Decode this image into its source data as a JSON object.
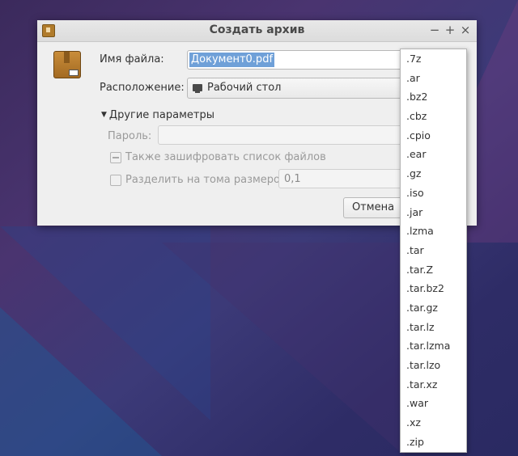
{
  "window": {
    "title": "Создать архив",
    "controls": {
      "minimize": "−",
      "maximize": "+",
      "close": "×"
    }
  },
  "form": {
    "filename_label": "Имя файла:",
    "filename_value": "Документ0.pdf",
    "location_label": "Расположение:",
    "location_value": "Рабочий стол",
    "more_options_label": "Другие параметры",
    "password_label": "Пароль:",
    "encrypt_list_label": "Также зашифровать список файлов",
    "split_label": "Разделить на тома размером",
    "split_value": "0,1",
    "cancel_label": "Отмена"
  },
  "extension_menu": {
    "items": [
      ".7z",
      ".ar",
      ".bz2",
      ".cbz",
      ".cpio",
      ".ear",
      ".gz",
      ".iso",
      ".jar",
      ".lzma",
      ".tar",
      ".tar.Z",
      ".tar.bz2",
      ".tar.gz",
      ".tar.lz",
      ".tar.lzma",
      ".tar.lzo",
      ".tar.xz",
      ".war",
      ".xz",
      ".zip"
    ]
  }
}
